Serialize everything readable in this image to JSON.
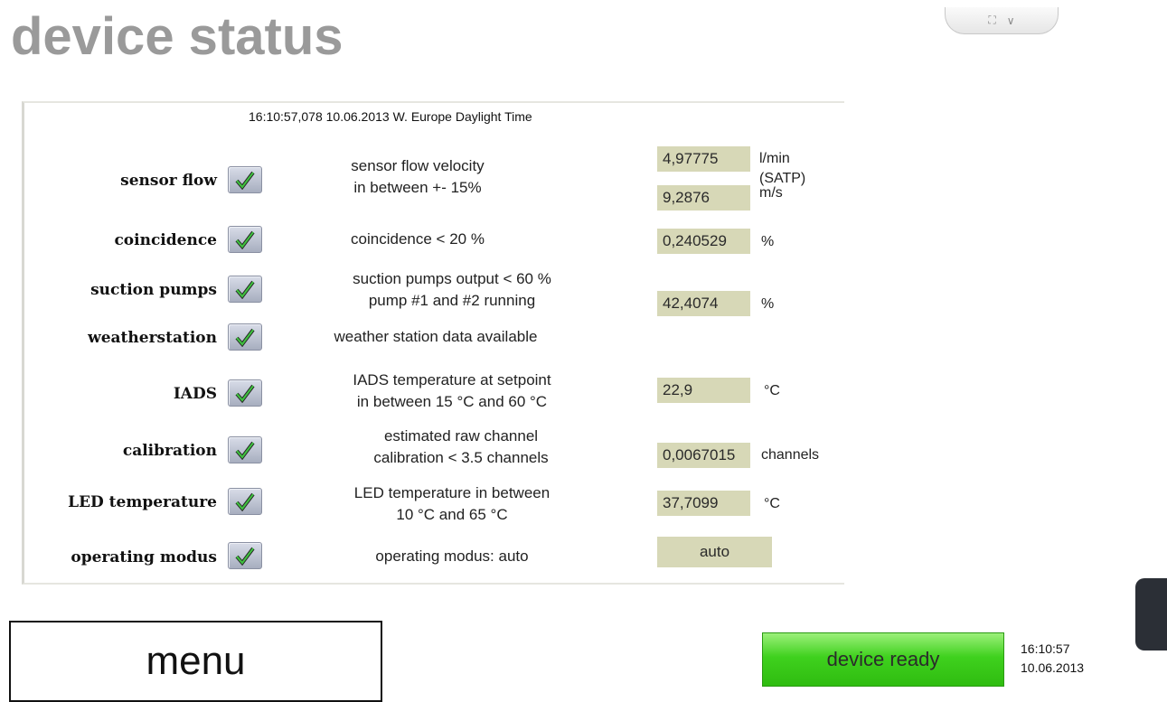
{
  "title": "device status",
  "window_controls": {
    "resize_glyph": "⛶",
    "chevron_glyph": "∨"
  },
  "panel": {
    "timestamp": "16:10:57,078  10.06.2013  W. Europe Daylight Time"
  },
  "rows": [
    {
      "label": "sensor flow",
      "status": "ok",
      "description": [
        "sensor flow velocity",
        "in between +- 15%"
      ],
      "values": [
        "4,97775",
        "9,2876"
      ],
      "units": [
        "l/min",
        "(SATP)",
        "m/s"
      ]
    },
    {
      "label": "coincidence",
      "status": "ok",
      "description": [
        "coincidence < 20 %"
      ],
      "values": [
        "0,240529"
      ],
      "units": [
        "%"
      ]
    },
    {
      "label": "suction pumps",
      "status": "ok",
      "description": [
        "suction pumps output < 60 %",
        "pump #1 and #2 running"
      ],
      "values": [
        "42,4074"
      ],
      "units": [
        "%"
      ]
    },
    {
      "label": "weatherstation",
      "status": "ok",
      "description": [
        "weather station data available"
      ],
      "values": [],
      "units": []
    },
    {
      "label": "IADS",
      "status": "ok",
      "description": [
        "IADS temperature at setpoint",
        "in between 15 °C and 60 °C"
      ],
      "values": [
        "22,9"
      ],
      "units": [
        "°C"
      ]
    },
    {
      "label": "calibration",
      "status": "ok",
      "description": [
        "estimated raw channel",
        "calibration < 3.5 channels"
      ],
      "values": [
        "0,0067015"
      ],
      "units": [
        "channels"
      ]
    },
    {
      "label": "LED temperature",
      "status": "ok",
      "description": [
        "LED temperature in between",
        "10 °C and 65 °C"
      ],
      "values": [
        "37,7099"
      ],
      "units": [
        "°C"
      ]
    },
    {
      "label": "operating modus",
      "status": "ok",
      "description": [
        "operating modus: auto"
      ],
      "values": [
        "auto"
      ],
      "units": []
    }
  ],
  "menu_button": {
    "label": "menu"
  },
  "status_button": {
    "label": "device ready",
    "color": "#3fd11e"
  },
  "clock": {
    "time": "16:10:57",
    "date": "10.06.2013"
  },
  "colors": {
    "title": "#9a9a9a",
    "value_box": "#d7d8b7",
    "check_green": "#2e9a2e"
  },
  "icons": {
    "status_ok": "checkmark-icon"
  }
}
